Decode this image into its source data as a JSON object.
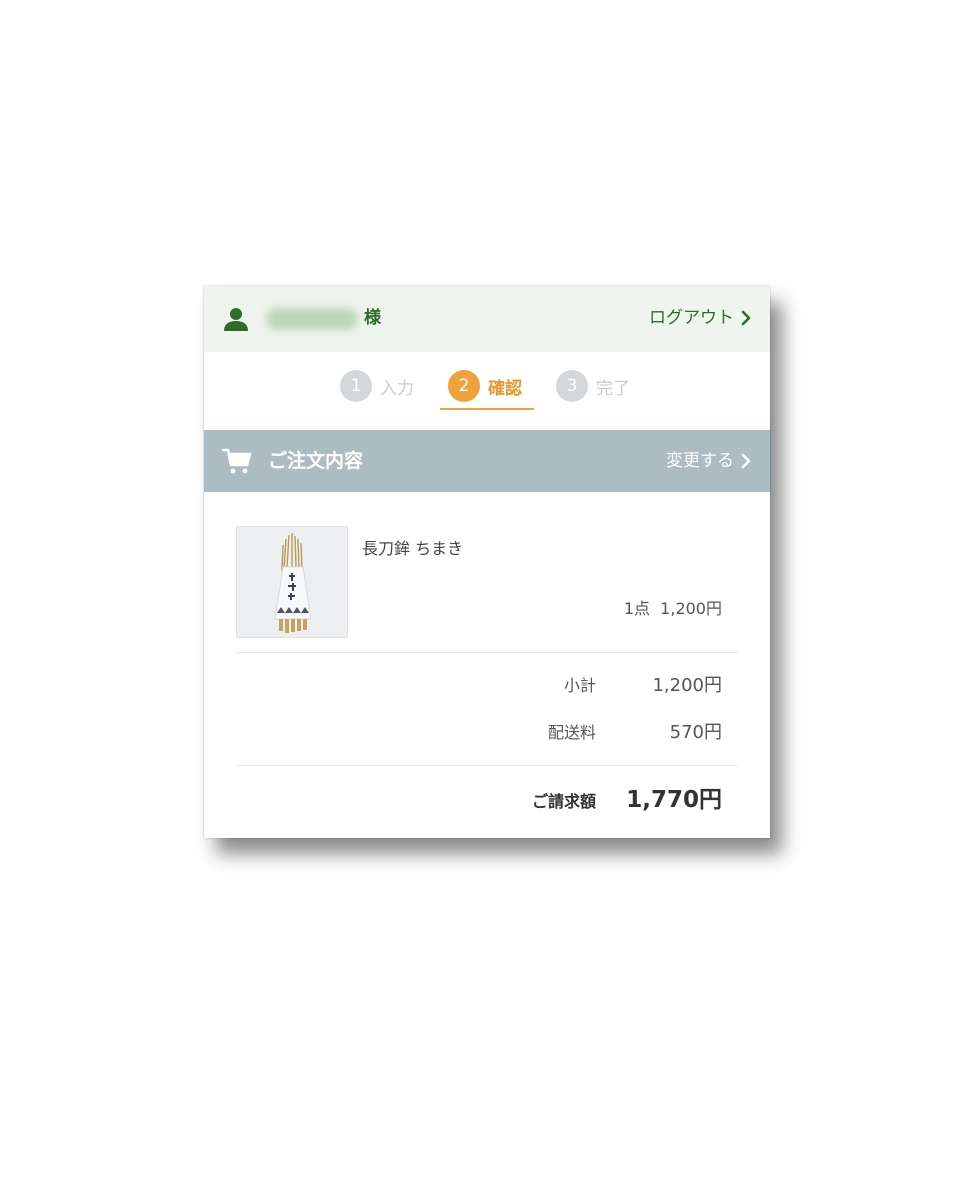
{
  "user": {
    "honorific": "様",
    "logout_label": "ログアウト",
    "icon": "user-icon"
  },
  "steps": [
    {
      "number": "1",
      "label": "入力",
      "state": "inactive"
    },
    {
      "number": "2",
      "label": "確認",
      "state": "active"
    },
    {
      "number": "3",
      "label": "完了",
      "state": "inactive"
    }
  ],
  "order_section": {
    "title": "ご注文内容",
    "change_label": "変更する",
    "icon": "cart-icon"
  },
  "item": {
    "name": "長刀鉾 ちまき",
    "qty_price": "1点  1,200円"
  },
  "summary": {
    "subtotal_label": "小計",
    "subtotal_value": "1,200円",
    "shipping_label": "配送料",
    "shipping_value": "570円",
    "total_label": "ご請求額",
    "total_value": "1,770円"
  },
  "colors": {
    "brand_green": "#2f6b2a",
    "userbar_bg": "#eef5ec",
    "accent_orange": "#f0a23a",
    "section_header_bg": "#adbcc3",
    "inactive_step": "#d4d8db"
  }
}
